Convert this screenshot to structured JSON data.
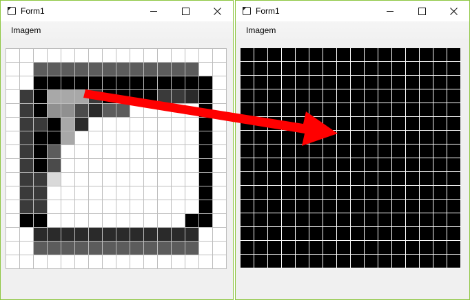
{
  "left_window": {
    "title": "Form1",
    "menu": "Imagem",
    "pixels": [
      "0000000000000000",
      "0022222222222200",
      "0044444444444440",
      "0346663444433540",
      "0348875220000040",
      "0334650000000040",
      "0344600000000040",
      "0342000000000040",
      "0347000000000040",
      "0339000000000040",
      "0330000000000040",
      "0330000000000040",
      "0440000000000440",
      "0055555555555500",
      "0022222222222200",
      "0000000000000000"
    ]
  },
  "right_window": {
    "title": "Form1",
    "menu": "Imagem"
  },
  "palette": {
    "0": "#ffffff",
    "1": "#e6e6e6",
    "2": "#5c5c5c",
    "3": "#3a3a3a",
    "4": "#000000",
    "5": "#2a2a2a",
    "6": "#a8a8a8",
    "7": "#4b4b4b",
    "8": "#909090",
    "9": "#d9d9d9"
  },
  "arrow_color": "#ff0000"
}
